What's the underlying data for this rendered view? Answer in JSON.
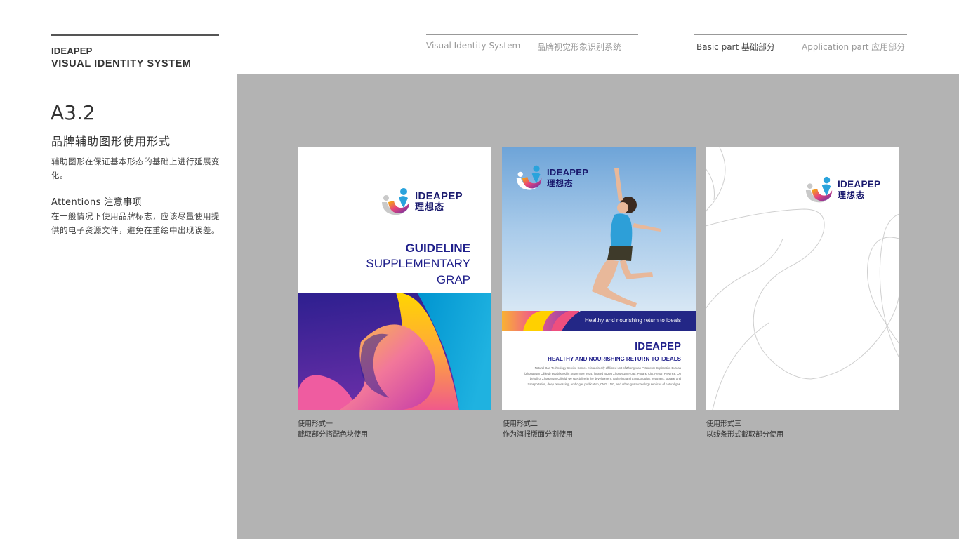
{
  "sidebar": {
    "brand_name": "IDEAPEP",
    "brand_subtitle": "VISUAL IDENTITY SYSTEM",
    "section_code": "A3.2",
    "section_title": "品牌辅助图形使用形式",
    "section_desc": "辅助图形在保证基本形态的基础上进行延展变化。",
    "attention_title": "Attentions 注意事项",
    "attention_desc": "在一般情况下使用品牌标志，应该尽量使用提供的电子资源文件，避免在重绘中出现误差。"
  },
  "nav": {
    "vis_en": "Visual Identity System",
    "vis_cn": "品牌视觉形象识别系统",
    "basic": "Basic part  基础部分",
    "application": "Application part  应用部分"
  },
  "logo": {
    "en": "IDEAPEP",
    "cn": "理想态"
  },
  "card1": {
    "title_bold": "GUIDELINE",
    "line2": "SUPPLEMENTARY",
    "line3": "GRAP",
    "caption1": "使用形式一",
    "caption2": "截取部分搭配色块使用"
  },
  "card2": {
    "band_text": "Healthy and nourishing return to ideals",
    "title": "IDEAPEP",
    "subtitle": "HEALTHY AND NOURISHING RETURN TO IDEALS",
    "body": "Natural Gas Technology Service Center. It is a directly affiliated unit of Zhongyuan Petroleum Exploration Bureau (Zhongyuan Oilfield) established in September 2014, located at 298 Zhongyuan Road, Puyang City, Henan Province. On behalf of Zhongyuan Oilfield, we specialize in the development, gathering and transportation, treatment, storage and transportation, deep processing, acidic gas purification, CNG, LNG, and urban gas technology services of natural gas.",
    "caption1": "使用形式二",
    "caption2": "作为海报版面分割使用"
  },
  "card3": {
    "caption1": "使用形式三",
    "caption2": "以线条形式截取部分使用"
  },
  "colors": {
    "brand_blue": "#1e1e8a",
    "panel_grey": "#b3b3b3",
    "navy_band": "#232786"
  }
}
